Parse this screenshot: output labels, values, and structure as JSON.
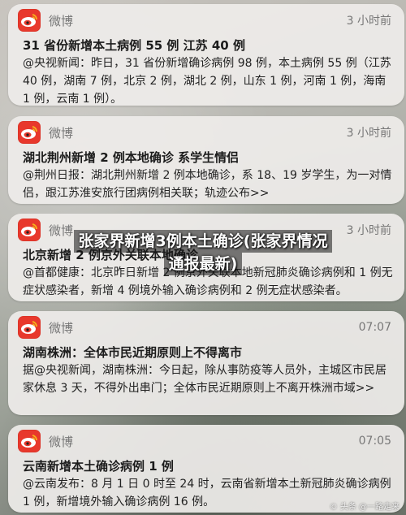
{
  "notifications": [
    {
      "app": "微博",
      "time": "3 小时前",
      "title": "31 省份新增本土病例 55 例 江苏 40 例",
      "body": "@央视新闻：昨日，31 省份新增确诊病例 98 例，本土病例 55 例（江苏 40 例，湖南 7 例，北京 2 例，湖北 2 例，山东 1 例，河南 1 例，海南 1 例，云南 1 例）。"
    },
    {
      "app": "微博",
      "time": "3 小时前",
      "title": "湖北荆州新增 2 例本地确诊 系学生情侣",
      "body": "@荆州日报：湖北荆州新增 2 例本地确诊，系 18、19 岁学生，为一对情侣，跟江苏淮安旅行团病例相关联；轨迹公布>>"
    },
    {
      "app": "微博",
      "time": "3 小时前",
      "title": "北京新增 2 例京外关联本地确诊",
      "body": "@首都健康：北京昨日新增 2 例京外关联本地新冠肺炎确诊病例和 1 例无症状感染者，新增 4 例境外输入确诊病例和 2 例无症状感染者。"
    },
    {
      "app": "微博",
      "time": "07:07",
      "title": "湖南株洲：全体市民近期原则上不得离市",
      "body": "据@央视新闻，湖南株洲：今日起，除从事防疫等人员外，主城区市民居家休息 3 天，不得外出串门；全体市民近期原则上不离开株洲市域>>"
    },
    {
      "app": "微博",
      "time": "07:05",
      "title": "云南新增本土确诊病例 1 例",
      "body": "@云南发布：8 月 1 日 0 时至 24 时，云南省新增本土新冠肺炎确诊病例 1 例，新增境外输入确诊病例 16 例。"
    }
  ],
  "overlay": {
    "line1": "张家界新增3例本土确诊(张家界情况",
    "line2": "通报最新)"
  },
  "watermark": "©  头条 @一路走来"
}
